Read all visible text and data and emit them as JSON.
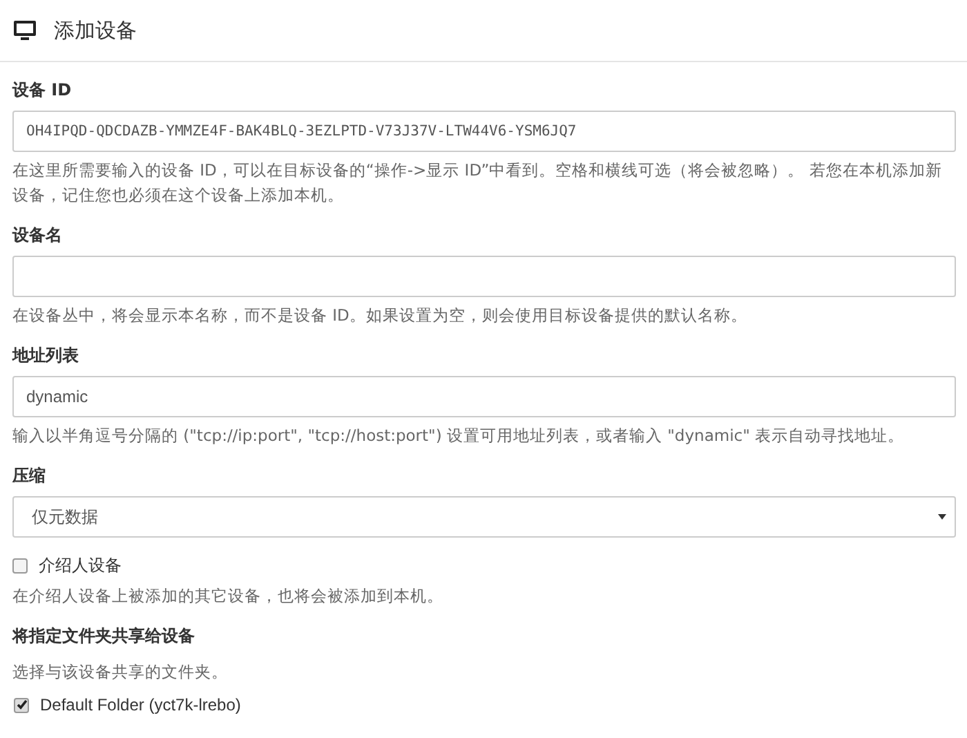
{
  "dialog": {
    "title": "添加设备"
  },
  "fields": [
    {
      "kind": "code",
      "label": "设备 ID",
      "value": "OH4IPQD-QDCDAZB-YMMZE4F-BAK4BLQ-3EZLPTD-V73J37V-LTW44V6-YSM6JQ7",
      "help": "在这里所需要输入的设备 ID，可以在目标设备的“操作->显示 ID”中看到。空格和横线可选（将会被忽略）。 若您在本机添加新设备，记住您也必须在这个设备上添加本机。"
    },
    {
      "kind": "text",
      "label": "设备名",
      "help": "在设备丛中，将会显示本名称，而不是设备 ID。如果设置为空，则会使用目标设备提供的默认名称。"
    },
    {
      "kind": "text",
      "label": "地址列表",
      "value": "dynamic",
      "help": "输入以半角逗号分隔的 (\"tcp://ip:port\", \"tcp://host:port\") 设置可用地址列表，或者输入 \"dynamic\" 表示自动寻找地址。"
    },
    {
      "kind": "select",
      "label": "压缩",
      "value": "仅元数据"
    },
    {
      "kind": "checkbox",
      "label": "介绍人设备",
      "checked": false,
      "help": "在介绍人设备上被添加的其它设备，也将会被添加到本机。"
    },
    {
      "kind": "section",
      "label": "将指定文件夹共享给设备",
      "help": "选择与该设备共享的文件夹。",
      "folders": [
        {
          "label": "Default Folder (yct7k-lrebo)",
          "checked": true
        }
      ]
    }
  ]
}
